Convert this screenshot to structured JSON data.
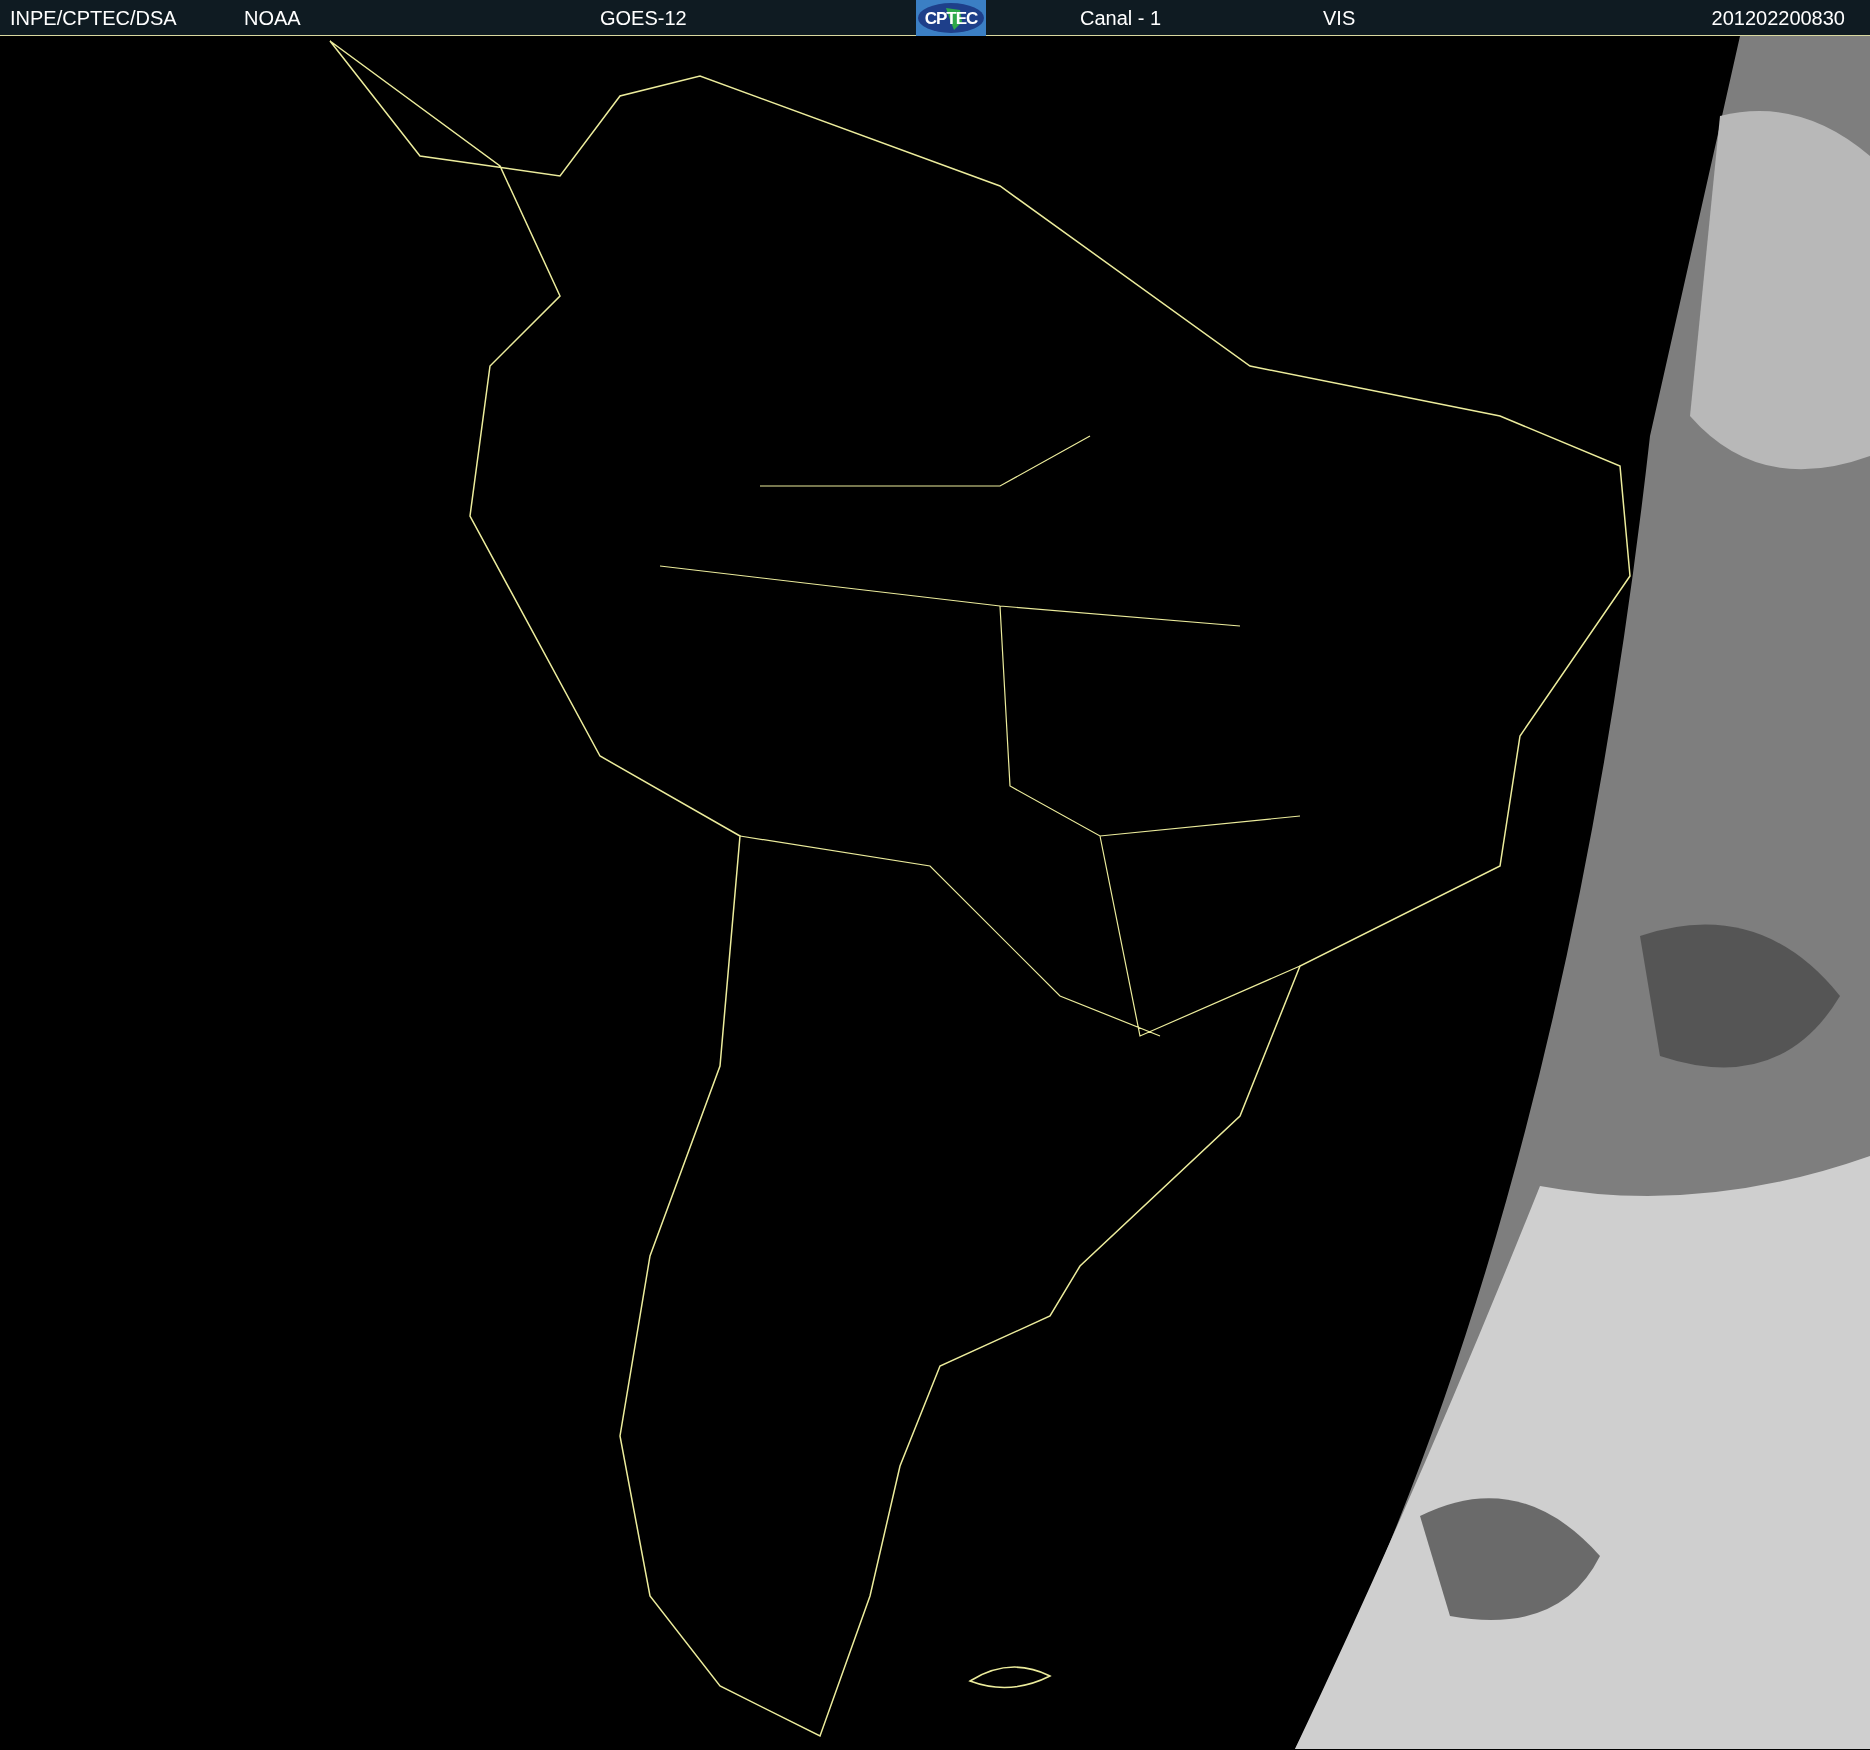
{
  "header": {
    "items": [
      {
        "kind": "text",
        "text": "INPE/CPTEC/DSA"
      },
      {
        "kind": "text",
        "text": "NOAA"
      },
      {
        "kind": "text",
        "text": "GOES-12"
      },
      {
        "kind": "logo",
        "text": "CPTEC"
      },
      {
        "kind": "text",
        "text": "Canal - 1"
      },
      {
        "kind": "text",
        "text": "VIS"
      },
      {
        "kind": "text",
        "text": "201202200830"
      }
    ]
  }
}
